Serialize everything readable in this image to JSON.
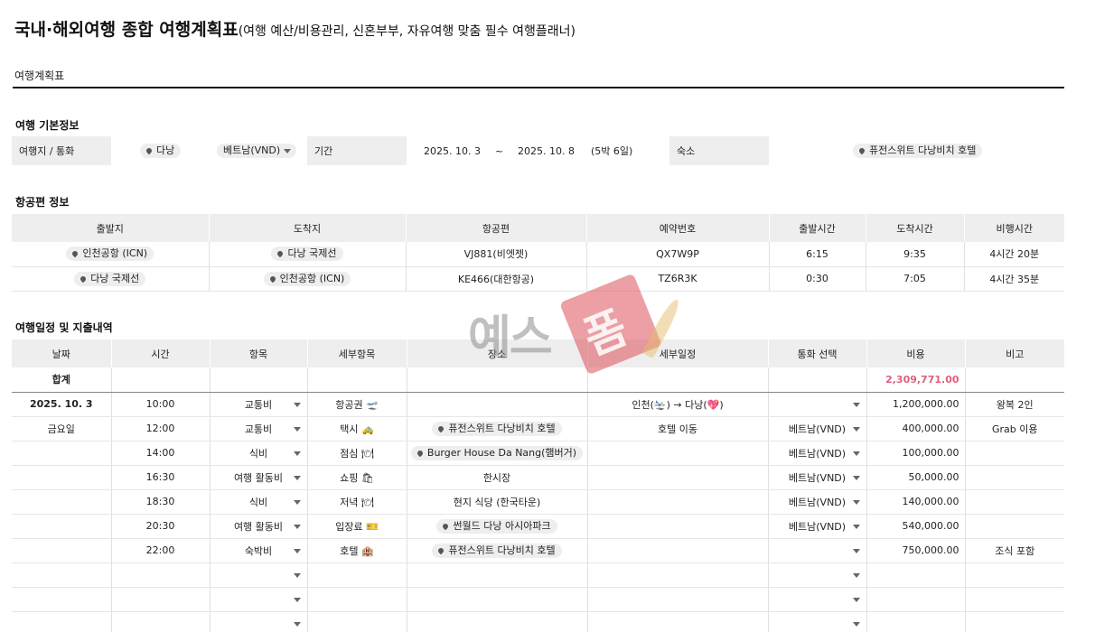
{
  "title": {
    "main": "국내·해외여행 종합 여행계획표",
    "sub": "(여행 예산/비용관리, 신혼부부, 자유여행 맞춤 필수 여행플래너)"
  },
  "tab": "여행계획표",
  "basic": {
    "section": "여행 기본정보",
    "dest_label": "여행지 / 통화",
    "dest": "다낭",
    "currency": "베트남(VND)",
    "period_label": "기간",
    "start": "2025. 10. 3",
    "tilde": "~",
    "end": "2025. 10. 8",
    "nights": "(5박 6일)",
    "lodging_label": "숙소",
    "lodging": "퓨전스위트 다낭비치 호텔"
  },
  "flight": {
    "section": "항공편 정보",
    "headers": [
      "출발지",
      "도착지",
      "항공편",
      "예약번호",
      "출발시간",
      "도착시간",
      "비행시간"
    ],
    "rows": [
      {
        "from": "인천공항 (ICN)",
        "to": "다낭 국제선",
        "flight": "VJ881(비엣젯)",
        "booking": "QX7W9P",
        "dep": "6:15",
        "arr": "9:35",
        "dur": "4시간 20분"
      },
      {
        "from": "다낭 국제선",
        "to": "인천공항 (ICN)",
        "flight": "KE466(대한항공)",
        "booking": "TZ6R3K",
        "dep": "0:30",
        "arr": "7:05",
        "dur": "4시간 35분"
      }
    ]
  },
  "schedule": {
    "section": "여행일정 및 지출내역",
    "headers": [
      "날짜",
      "시간",
      "항목",
      "세부항목",
      "장소",
      "세부일정",
      "통화 선택",
      "비용",
      "비고"
    ],
    "total_label": "합계",
    "total_value": "2,309,771.00",
    "date": "2025. 10. 3",
    "weekday": "금요일",
    "rows": [
      {
        "time": "10:00",
        "cat": "교통비",
        "detail": "항공권 🛫",
        "place": "",
        "plan": "인천(🛬) → 다낭(💖)",
        "cur": "",
        "cost": "1,200,000.00",
        "note": "왕복 2인"
      },
      {
        "time": "12:00",
        "cat": "교통비",
        "detail": "택시 🚕",
        "place": "퓨전스위트 다낭비치 호텔",
        "plan": "호텔 이동",
        "cur": "베트남(VND)",
        "cost": "400,000.00",
        "note": "Grab 이용"
      },
      {
        "time": "14:00",
        "cat": "식비",
        "detail": "점심 🍽",
        "place": "Burger House Da Nang(햄버거)",
        "plan": "",
        "cur": "베트남(VND)",
        "cost": "100,000.00",
        "note": ""
      },
      {
        "time": "16:30",
        "cat": "여행 활동비",
        "detail": "쇼핑 🛍",
        "place": "한시장",
        "plan": "",
        "cur": "베트남(VND)",
        "cost": "50,000.00",
        "note": ""
      },
      {
        "time": "18:30",
        "cat": "식비",
        "detail": "저녁 🍽",
        "place": "현지 식당 (한국타운)",
        "plan": "",
        "cur": "베트남(VND)",
        "cost": "140,000.00",
        "note": ""
      },
      {
        "time": "20:30",
        "cat": "여행 활동비",
        "detail": "입장료 🎫",
        "place": "썬월드 다낭 아시아파크",
        "plan": "",
        "cur": "베트남(VND)",
        "cost": "540,000.00",
        "note": ""
      },
      {
        "time": "22:00",
        "cat": "숙박비",
        "detail": "호텔 🏨",
        "place": "퓨전스위트 다낭비치 호텔",
        "plan": "",
        "cur": "",
        "cost": "750,000.00",
        "note": "조식 포함"
      }
    ]
  },
  "watermark": {
    "text1": "예스",
    "text2": "폼"
  }
}
